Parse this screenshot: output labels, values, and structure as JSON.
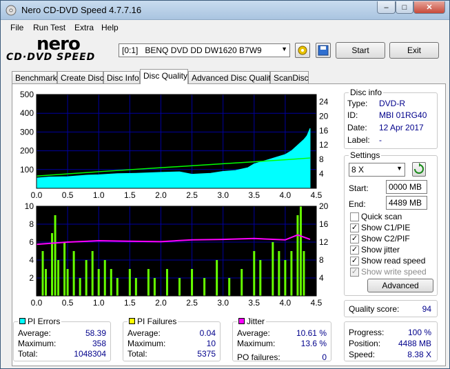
{
  "window": {
    "title": "Nero CD-DVD Speed 4.7.7.16"
  },
  "menu": [
    "File",
    "Run Test",
    "Extra",
    "Help"
  ],
  "logo": {
    "line1": "nero",
    "line2": "CD·DVD SPEED"
  },
  "drive": {
    "selected": "[0:1]   BENQ DVD DD DW1620 B7W9"
  },
  "buttons": {
    "start": "Start",
    "exit": "Exit",
    "advanced": "Advanced"
  },
  "tabs": [
    "Benchmark",
    "Create Disc",
    "Disc Info",
    "Disc Quality",
    "Advanced Disc Quality",
    "ScanDisc"
  ],
  "disc_info": {
    "title": "Disc info",
    "type_label": "Type:",
    "type": "DVD-R",
    "id_label": "ID:",
    "id": "MBI 01RG40",
    "date_label": "Date:",
    "date": "12 Apr 2017",
    "label_label": "Label:",
    "label": "-"
  },
  "settings": {
    "title": "Settings",
    "speed": "8 X",
    "start_label": "Start:",
    "start": "0000 MB",
    "end_label": "End:",
    "end": "4489 MB",
    "quick_scan": "Quick scan",
    "show_c1pie": "Show C1/PIE",
    "show_c2pif": "Show C2/PIF",
    "show_jitter": "Show jitter",
    "show_read_speed": "Show read speed",
    "show_write_speed": "Show write speed"
  },
  "quality": {
    "label": "Quality score:",
    "score": "94"
  },
  "progress": {
    "progress_label": "Progress:",
    "progress": "100 %",
    "position_label": "Position:",
    "position": "4488 MB",
    "speed_label": "Speed:",
    "speed": "8.38 X"
  },
  "stats": {
    "pi_errors": {
      "title": "PI Errors",
      "avg_label": "Average:",
      "avg": "58.39",
      "max_label": "Maximum:",
      "max": "358",
      "total_label": "Total:",
      "total": "1048304"
    },
    "pi_failures": {
      "title": "PI Failures",
      "avg_label": "Average:",
      "avg": "0.04",
      "max_label": "Maximum:",
      "max": "10",
      "total_label": "Total:",
      "total": "5375"
    },
    "jitter": {
      "title": "Jitter",
      "avg_label": "Average:",
      "avg": "10.61 %",
      "max_label": "Maximum:",
      "max": "13.6 %",
      "po_label": "PO failures:",
      "po": "0"
    }
  },
  "colors": {
    "pi_errors": "#00ffff",
    "pi_failures": "#ffff00",
    "jitter": "#ff00ff",
    "read_speed": "#00ff00",
    "pif_bars": "#66ff00",
    "plot_bg": "#000000",
    "grid": "#0000a0"
  },
  "chart_data": [
    {
      "type": "area",
      "name": "PI Errors",
      "x_ticks": [
        "0.0",
        "0.5",
        "1.0",
        "1.5",
        "2.0",
        "2.5",
        "3.0",
        "3.5",
        "4.0",
        "4.5"
      ],
      "y_ticks_left": [
        "100",
        "200",
        "300",
        "400",
        "500"
      ],
      "y_ticks_right": [
        "4",
        "8",
        "12",
        "16",
        "20",
        "24"
      ],
      "xlim": [
        0,
        4.5
      ],
      "ylim_left": [
        0,
        500
      ],
      "ylim_right": [
        0,
        26
      ],
      "pi_errors_x": [
        0,
        0.2,
        0.5,
        0.8,
        1.0,
        1.3,
        1.6,
        2.0,
        2.3,
        2.5,
        2.8,
        3.0,
        3.2,
        3.4,
        3.5,
        3.7,
        3.9,
        4.0,
        4.1,
        4.2,
        4.3,
        4.35,
        4.4
      ],
      "pi_errors_y": [
        55,
        60,
        62,
        70,
        72,
        78,
        80,
        85,
        88,
        75,
        80,
        90,
        95,
        110,
        130,
        150,
        170,
        180,
        200,
        230,
        260,
        280,
        320
      ],
      "read_speed_x": [
        0,
        1.0,
        2.0,
        3.0,
        4.0,
        4.4
      ],
      "read_speed_y": [
        3.4,
        4.6,
        5.7,
        6.8,
        7.9,
        8.4
      ]
    },
    {
      "type": "bar",
      "name": "PI Failures",
      "x_ticks": [
        "0.0",
        "0.5",
        "1.0",
        "1.5",
        "2.0",
        "2.5",
        "3.0",
        "3.5",
        "4.0",
        "4.5"
      ],
      "y_ticks_left": [
        "2",
        "4",
        "6",
        "8",
        "10"
      ],
      "y_ticks_right": [
        "4",
        "8",
        "12",
        "16",
        "20"
      ],
      "xlim": [
        0,
        4.5
      ],
      "ylim_left": [
        0,
        10
      ],
      "ylim_right": [
        0,
        20
      ],
      "pif_x": [
        0.1,
        0.15,
        0.25,
        0.3,
        0.35,
        0.45,
        0.5,
        0.6,
        0.7,
        0.8,
        0.9,
        1.0,
        1.1,
        1.2,
        1.3,
        1.5,
        1.6,
        1.8,
        1.9,
        2.1,
        2.3,
        2.5,
        2.7,
        2.9,
        3.1,
        3.3,
        3.5,
        3.6,
        3.8,
        3.9,
        4.0,
        4.1,
        4.2,
        4.25,
        4.3
      ],
      "pif_y": [
        5,
        3,
        7,
        9,
        4,
        6,
        3,
        5,
        2,
        4,
        5,
        3,
        4,
        3,
        2,
        3,
        2,
        3,
        2,
        3,
        2,
        3,
        2,
        4,
        2,
        3,
        5,
        4,
        6,
        5,
        4,
        5,
        9,
        10,
        5
      ],
      "jitter_x": [
        0,
        0.5,
        1.0,
        1.5,
        2.0,
        2.5,
        3.0,
        3.5,
        4.0,
        4.2,
        4.4
      ],
      "jitter_y": [
        11.5,
        12,
        12.3,
        12.2,
        12.1,
        12.5,
        12.6,
        12.8,
        12.5,
        13.6,
        12.6
      ]
    }
  ]
}
